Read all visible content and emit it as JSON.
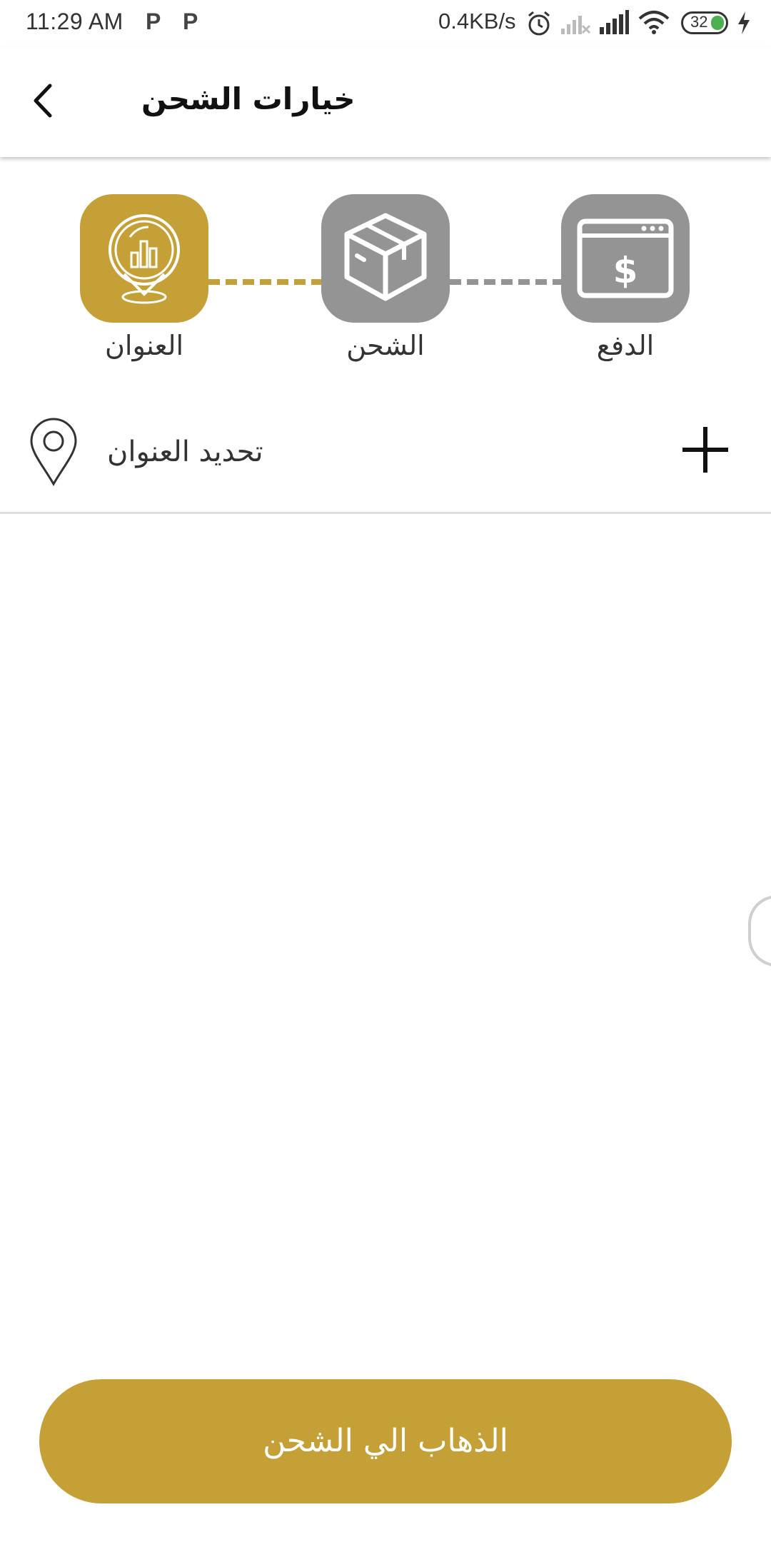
{
  "status_bar": {
    "time": "11:29 AM",
    "notification_icons": [
      "P",
      "P"
    ],
    "network_speed": "0.4KB/s",
    "battery_level": "32",
    "icons": [
      "alarm-icon",
      "signal-off-icon",
      "signal-icon",
      "wifi-icon",
      "battery-icon",
      "charging-icon"
    ]
  },
  "header": {
    "title": "خيارات الشحن",
    "back_icon": "back-arrow-icon"
  },
  "stepper": {
    "steps": [
      {
        "label": "العنوان",
        "icon": "location-chart-icon",
        "state": "active",
        "color": "#c4a036"
      },
      {
        "label": "الشحن",
        "icon": "box-icon",
        "state": "inactive",
        "color": "#949494"
      },
      {
        "label": "الدفع",
        "icon": "payment-browser-icon",
        "state": "inactive",
        "color": "#949494"
      }
    ]
  },
  "address": {
    "label": "تحديد العنوان",
    "pin_icon": "map-pin-icon",
    "add_icon": "plus-icon"
  },
  "footer": {
    "button_label": "الذهاب الي الشحن"
  },
  "colors": {
    "accent": "#c4a036",
    "inactive": "#949494"
  }
}
